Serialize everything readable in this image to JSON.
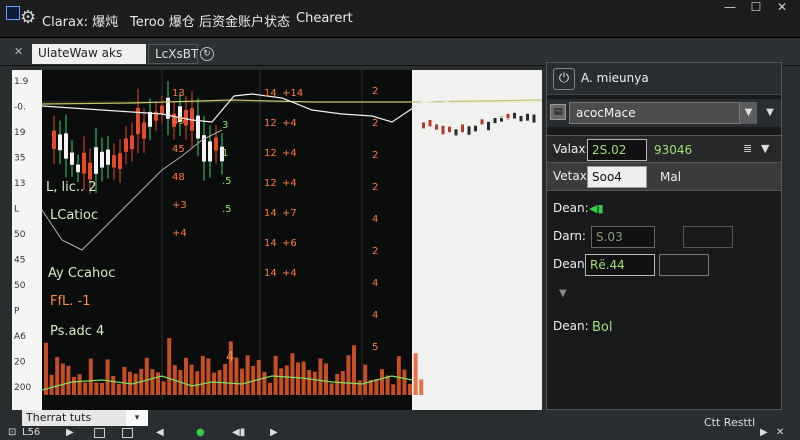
{
  "window": {
    "title_app": "Clarax: 爆炖",
    "title_doc": "Teroo 爆仓 后资金账户状态",
    "title_extra": "Chearert",
    "minimize": "—",
    "maximize": "☐",
    "close": "✕"
  },
  "tabs": [
    {
      "label": "UlateWaw aks"
    },
    {
      "label": "LcXsBT"
    }
  ],
  "chart": {
    "left_axis_labels": [
      "1.9",
      "-0.",
      "19",
      "35",
      "13",
      "L",
      "50",
      "45",
      "50",
      "P",
      "A6",
      "20",
      "200"
    ],
    "orange_labels_col1": [
      "13",
      "45",
      "45",
      "48",
      "+3",
      "+4"
    ],
    "orange_labels_col2": [
      "14",
      "+14",
      "12",
      "+4",
      "12",
      "+4",
      "12",
      "+4",
      "14",
      "+7",
      "14",
      "+6",
      "14",
      "+4"
    ],
    "right_col_labels": [
      "2",
      "2",
      "2",
      "2",
      "4",
      "2",
      "4",
      "4",
      "5"
    ],
    "green_labels": [
      "3",
      "1",
      ".5",
      ".5"
    ],
    "overlay": {
      "l_label": "L, lic.. 2",
      "catio": "LCatioc",
      "cachoc": "Ay Ccahoc",
      "fcl": "FfL. -1",
      "psadc": "Ps.adc 4",
      "four": "4"
    },
    "colors": {
      "up": "#3bd06a",
      "down": "#e24a2a",
      "line_white": "#f0f0f0",
      "line_olive": "#c9c66b",
      "volume": "#e65a2a"
    }
  },
  "panel": {
    "title": "A. mieunya",
    "select_value": "acocMace",
    "valax_label": "Valax:",
    "valax_value": "2S.02",
    "valax_value2": "93046",
    "vetax_label": "Vetax:",
    "vetax_value": "Soo4",
    "vetax_unit": "Mal",
    "dean_labels": [
      "Dean:",
      "Darn:",
      "Dean:",
      "Dean:"
    ],
    "darn_value": "S.03",
    "dean_value_3": "Rё.44",
    "dean_value_4": "Bol"
  },
  "bottom": {
    "tab_label": "Therrat      tuts",
    "left_status": "L56",
    "right_status": "Ctt Resttl"
  }
}
